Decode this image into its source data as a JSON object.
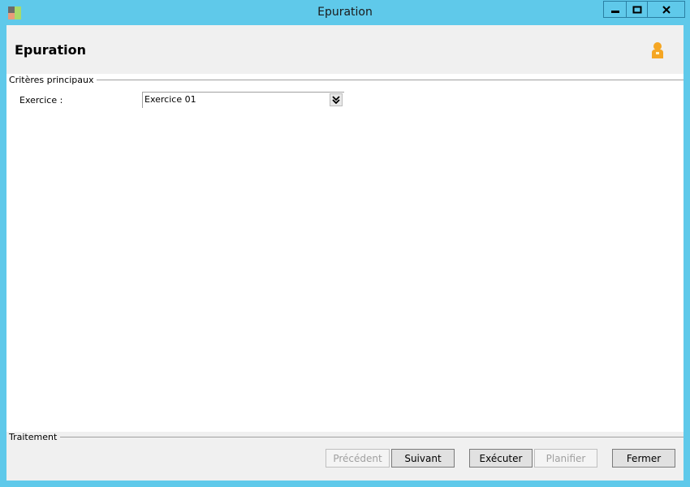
{
  "window": {
    "title": "Epuration",
    "controls": {
      "minimize": "minimize",
      "maximize": "maximize",
      "close": "close"
    }
  },
  "header": {
    "title": "Epuration",
    "user_icon": "user-icon"
  },
  "criteria": {
    "legend": "Critères principaux",
    "exercice_label": "Exercice :",
    "exercice_value": "Exercice 01"
  },
  "processing": {
    "legend": "Traitement",
    "buttons": {
      "previous": "Précédent",
      "next": "Suivant",
      "execute": "Exécuter",
      "schedule": "Planifier",
      "close": "Fermer"
    }
  },
  "colors": {
    "frame": "#5fc9ea",
    "panel": "#f0f0f0",
    "user_icon": "#f5a623"
  }
}
